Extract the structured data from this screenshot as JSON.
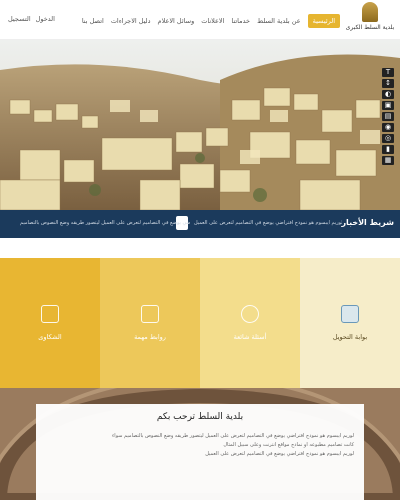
{
  "header": {
    "logo_text": "بلدية السلط الكبرى",
    "nav": [
      {
        "label": "الرئيسية",
        "active": true
      },
      {
        "label": "عن بلدية السلط",
        "active": false
      },
      {
        "label": "خدماتنا",
        "active": false
      },
      {
        "label": "الاعلانات",
        "active": false
      },
      {
        "label": "وسائل الاعلام",
        "active": false
      },
      {
        "label": "دليل الاجراءات",
        "active": false
      },
      {
        "label": "اتصل بنا",
        "active": false
      }
    ],
    "login_label": "الدخول",
    "register_label": "التسجيل"
  },
  "accessibility_icons": [
    "text-size-icon",
    "line-height-icon",
    "contrast-icon",
    "image-icon",
    "eye-icon",
    "grayscale-icon",
    "microphone-icon",
    "keyboard-icon"
  ],
  "ticker": {
    "label": "شريط الأخبار",
    "text1": "لوريم ايبسوم هو نموذج افتراضي يوضع في التصاميم لتعرض على العميل ليتصور طريقه وضع النصوص بالتصاميم",
    "text2": "لوريم ايبسوم هو نموذج افتراضي يوضع في التصاميم لتعرض على العميل"
  },
  "services": [
    {
      "label": "بوابة التحويل",
      "color": "#f6edc9",
      "light": true
    },
    {
      "label": "أسئلة شائعة",
      "color": "#f3dd8c",
      "light": false
    },
    {
      "label": "روابط مهمة",
      "color": "#edc85a",
      "light": false
    },
    {
      "label": "الشكاوى",
      "color": "#e8b632",
      "light": false
    }
  ],
  "welcome": {
    "title": "بلدية السلط ترحب بكم",
    "p1": "لوريم ايبسوم هو نموذج افتراضي يوضع في التصاميم لتعرض على العميل ليتصور طريقه وضع النصوص بالتصاميم سواء",
    "p2": "كانت تصاميم مطبوعه او نماذج مواقع انترنت وعلى سبيل المثال",
    "p3": "لوريم ايبسوم هو نموذج افتراضي يوضع في التصاميم لتعرض على العميل"
  }
}
